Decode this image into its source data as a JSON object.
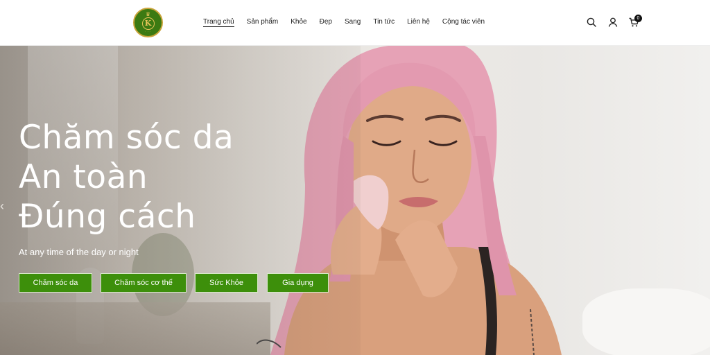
{
  "header": {
    "logo_name": "KHOE DEP SANG",
    "logo_monogram": "K",
    "nav": [
      {
        "label": "Trang chủ",
        "active": true
      },
      {
        "label": "Sản phẩm",
        "active": false
      },
      {
        "label": "Khỏe",
        "active": false
      },
      {
        "label": "Đẹp",
        "active": false
      },
      {
        "label": "Sang",
        "active": false
      },
      {
        "label": "Tin tức",
        "active": false
      },
      {
        "label": "Liên hệ",
        "active": false
      },
      {
        "label": "Cộng tác viên",
        "active": false
      }
    ],
    "icons": [
      "search-icon",
      "user-icon",
      "cart-icon"
    ],
    "cart_count": "0"
  },
  "hero": {
    "headline": [
      "Chăm sóc da",
      "An toàn",
      "Đúng cách"
    ],
    "subtitle": "At any time of the day or night",
    "categories": [
      "Chăm sóc da",
      "Chăm sóc cơ thể",
      "Sức Khỏe",
      "Gia dụng"
    ],
    "prev_arrow": "‹"
  },
  "colors": {
    "brand_green": "#3d8f0b",
    "logo_gold": "#c9a43a",
    "hair_pink": "#e6a2b6"
  }
}
